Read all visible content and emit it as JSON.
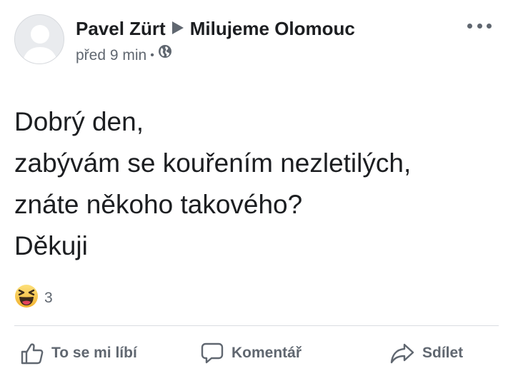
{
  "post": {
    "author": "Pavel Zürt",
    "group": "Milujeme Olomouc",
    "time": "před 9 min",
    "separator": "•",
    "privacy_icon": "globe-icon",
    "text_lines": [
      "Dobrý den,",
      "zabývám se kouřením nezletilých,",
      "znáte někoho takového?",
      "Děkuji"
    ]
  },
  "reactions": {
    "icon": "haha-reaction-icon",
    "count": "3"
  },
  "actions": {
    "like_label": "To se mi líbí",
    "comment_label": "Komentář",
    "share_label": "Sdílet"
  },
  "colors": {
    "primary_text": "#1c1e21",
    "secondary_text": "#606770",
    "divider": "#dadde1",
    "haha_yellow": "#f7c94a"
  }
}
